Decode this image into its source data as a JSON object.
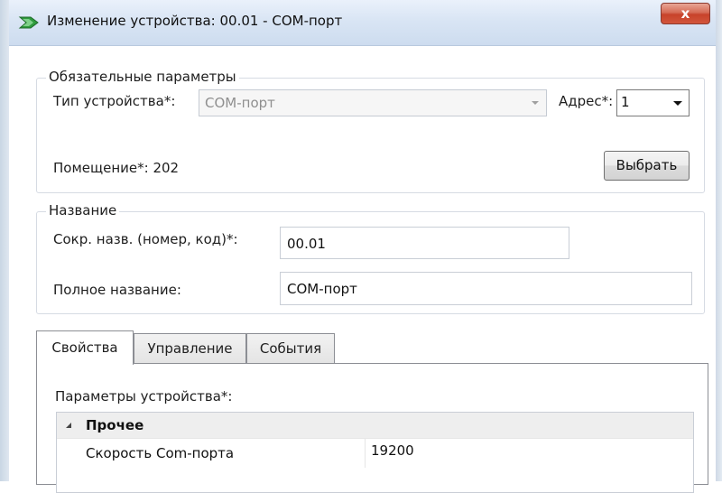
{
  "window": {
    "title": "Изменение устройства: 00.01 - COM-порт",
    "close_glyph": "x"
  },
  "required": {
    "legend": "Обязательные параметры",
    "device_type_label": "Тип устройства*:",
    "device_type_value": "COM-порт",
    "address_label": "Адрес*:",
    "address_value": "1",
    "room_label": "Помещение*: 202",
    "select_button": "Выбрать"
  },
  "name_group": {
    "legend": "Название",
    "short_label": "Сокр. назв. (номер, код)*:",
    "short_value": "00.01",
    "full_label": "Полное название:",
    "full_value": "COM-порт"
  },
  "tabs": [
    {
      "label": "Свойства",
      "active": true
    },
    {
      "label": "Управление",
      "active": false
    },
    {
      "label": "События",
      "active": false
    }
  ],
  "properties": {
    "header": "Параметры устройства*:",
    "category": "Прочее",
    "rows": [
      {
        "name": "Скорость Com-порта",
        "value": "19200"
      }
    ]
  },
  "colors": {
    "titlebar": "#d9e5f4",
    "close_button": "#c7422a",
    "app_icon": "#2e9b3c"
  }
}
